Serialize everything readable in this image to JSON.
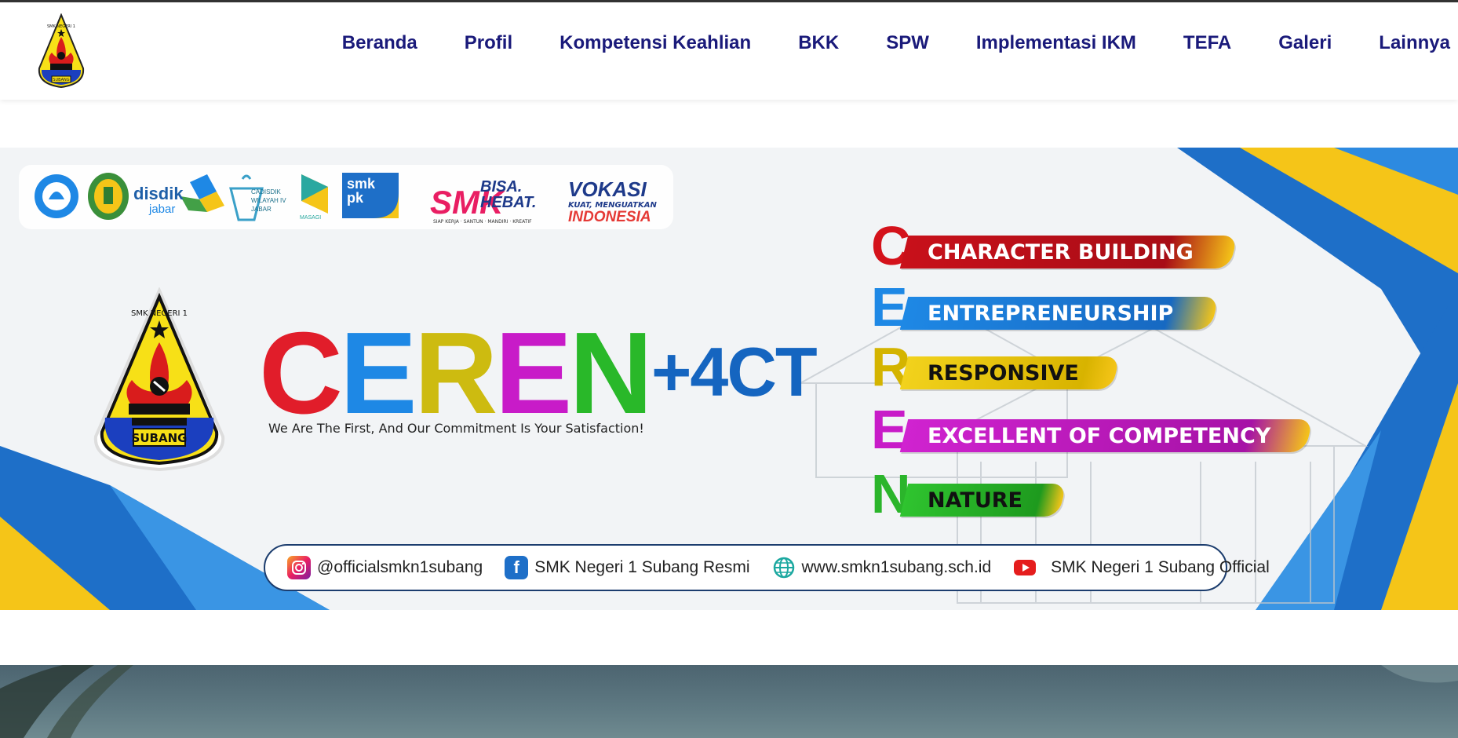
{
  "nav": {
    "items": [
      "Beranda",
      "Profil",
      "Kompetensi Keahlian",
      "BKK",
      "SPW",
      "Implementasi IKM",
      "TEFA",
      "Galeri",
      "Lainnya"
    ]
  },
  "logo": {
    "top_text": "SMK NEGERI 1",
    "bottom_text": "SUBANG"
  },
  "partners": {
    "disdik_1": "disdik",
    "disdik_2": "jabar",
    "cadisdik_1": "CADISDIK",
    "cadisdik_2": "WILAYAH IV",
    "cadisdik_3": "JABAR",
    "masagi": "MASAGI",
    "smkpk_1": "smk",
    "smkpk_2": "pk",
    "smk_bisa": "SMK",
    "bisa_hebat_1": "BISA.",
    "bisa_hebat_2": "HEBAT.",
    "bisa_hebat_sub": "SIAP KERJA · SANTUN · MANDIRI · KREATIF",
    "vokasi_1": "VOKASI",
    "vokasi_2": "KUAT, MENGUATKAN",
    "vokasi_3": "INDONESIA"
  },
  "hero": {
    "letters": [
      "C",
      "E",
      "R",
      "E",
      "N"
    ],
    "plus": "+4CT",
    "tagline": "We Are The First, And Our Commitment Is Your Satisfaction!"
  },
  "values": [
    {
      "letter": "C",
      "label": "CHARACTER BUILDING",
      "color": "#d4121b"
    },
    {
      "letter": "E",
      "label": "ENTREPRENEURSHIP",
      "color": "#1e88e5"
    },
    {
      "letter": "R",
      "label": "RESPONSIVE",
      "color": "#d4b400"
    },
    {
      "letter": "E",
      "label": "EXCELLENT OF COMPETENCY",
      "color": "#c81bc8"
    },
    {
      "letter": "N",
      "label": "NATURE",
      "color": "#2bb52b"
    }
  ],
  "social": {
    "instagram": "@officialsmkn1subang",
    "facebook": "SMK Negeri 1 Subang Resmi",
    "website": "www.smkn1subang.sch.id",
    "youtube": "SMK Negeri 1 Subang Official"
  },
  "colors": {
    "nav_text": "#1a1a7a",
    "banner_blue": "#1e6fc8",
    "banner_yellow": "#f5c518"
  }
}
